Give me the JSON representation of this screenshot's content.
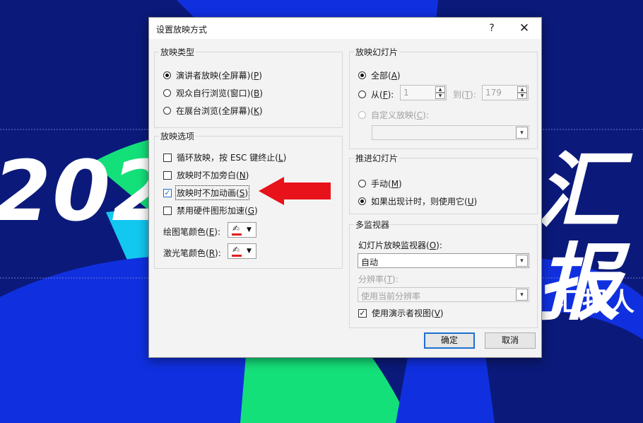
{
  "background": {
    "year_text": "202",
    "right_text": "汇报",
    "reporter_text": "汇报人"
  },
  "dialog": {
    "title": "设置放映方式",
    "help_label": "?",
    "close_label": "✕",
    "show_type": {
      "title": "放映类型",
      "options": [
        {
          "label": "演讲者放映(全屏幕)(",
          "key": "P",
          "selected": true
        },
        {
          "label": "观众自行浏览(窗口)(",
          "key": "B",
          "selected": false
        },
        {
          "label": "在展台浏览(全屏幕)(",
          "key": "K",
          "selected": false
        }
      ]
    },
    "show_options": {
      "title": "放映选项",
      "checkboxes": [
        {
          "label": "循环放映，按 ESC 键终止(",
          "key": "L",
          "checked": false
        },
        {
          "label": "放映时不加旁白(",
          "key": "N",
          "checked": false
        },
        {
          "label": "放映时不加动画(",
          "key": "S",
          "checked": true
        },
        {
          "label": "禁用硬件图形加速(",
          "key": "G",
          "checked": false
        }
      ],
      "pen_color_label": "绘图笔颜色(",
      "pen_color_key": "E",
      "laser_color_label": "激光笔颜色(",
      "laser_color_key": "R",
      "pen_color": "#e02020",
      "laser_color": "#e02020"
    },
    "show_slides": {
      "title": "放映幻灯片",
      "all_label": "全部(",
      "all_key": "A",
      "from_label": "从(",
      "from_key": "F",
      "from_value": "1",
      "to_label": "到(",
      "to_key": "T",
      "to_value": "179",
      "custom_label": "自定义放映(",
      "custom_key": "C"
    },
    "advance": {
      "title": "推进幻灯片",
      "manual_label": "手动(",
      "manual_key": "M",
      "timing_label": "如果出现计时，则使用它(",
      "timing_key": "U"
    },
    "monitors": {
      "title": "多监视器",
      "monitor_label": "幻灯片放映监视器(",
      "monitor_key": "O",
      "monitor_value": "自动",
      "resolution_label": "分辨率(",
      "resolution_key": "T",
      "resolution_value": "使用当前分辨率",
      "presenter_view_label": "使用演示者视图(",
      "presenter_view_key": "V",
      "presenter_view_checked": true
    },
    "ok_label": "确定",
    "cancel_label": "取消"
  },
  "colors": {
    "accent_blue": "#1f6fd1",
    "arrow_red": "#e8121a",
    "bg_navy": "#0b1a7a",
    "bg_blue": "#1030e0",
    "bg_green": "#14e07a"
  }
}
